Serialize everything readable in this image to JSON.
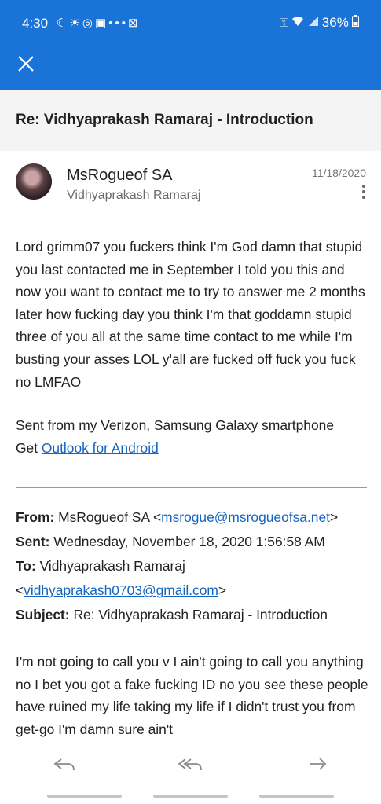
{
  "status_bar": {
    "time": "4:30",
    "battery": "36%",
    "icons": [
      "moon-icon",
      "weather-icon",
      "app-icon",
      "image-icon",
      "more-dots-icon",
      "close-box-icon",
      "key-icon",
      "wifi-icon",
      "signal-icon",
      "battery-icon"
    ]
  },
  "subject": "Re: Vidhyaprakash Ramaraj - Introduction",
  "message": {
    "sender": "MsRogueof SA",
    "recipient": "Vidhyaprakash Ramaraj",
    "date": "11/18/2020",
    "body": "Lord grimm07 you fuckers think I'm God damn that stupid you last contacted me in September I told you this and now you want to contact me to try to answer me 2 months later how fucking day you think I'm that goddamn stupid three of you all at the same time contact to me while I'm busting your asses LOL y'all are fucked off fuck you fuck no LMFAO",
    "signature_line1": "Sent from my Verizon, Samsung Galaxy smartphone",
    "signature_prefix": "Get ",
    "signature_link": "Outlook for Android"
  },
  "quoted_header": {
    "from_label": "From:",
    "from_name": " MsRogueof SA <",
    "from_email": "msrogue@msrogueofsa.net",
    "from_close": ">",
    "sent_label": "Sent:",
    "sent_value": " Wednesday, November 18, 2020 1:56:58 AM",
    "to_label": "To:",
    "to_name": " Vidhyaprakash Ramaraj",
    "to_open": "<",
    "to_email": "vidhyaprakash0703@gmail.com",
    "to_close": ">",
    "subject_label": "Subject:",
    "subject_value": " Re: Vidhyaprakash Ramaraj - Introduction"
  },
  "quoted_body": "I'm not going to call you v I ain't going to call you anything no I bet you got a fake fucking ID no you see these people have ruined my life taking my life if I didn't trust you from get-go I'm damn sure ain't",
  "colors": {
    "accent": "#1a73d6",
    "link": "#1565c0"
  }
}
